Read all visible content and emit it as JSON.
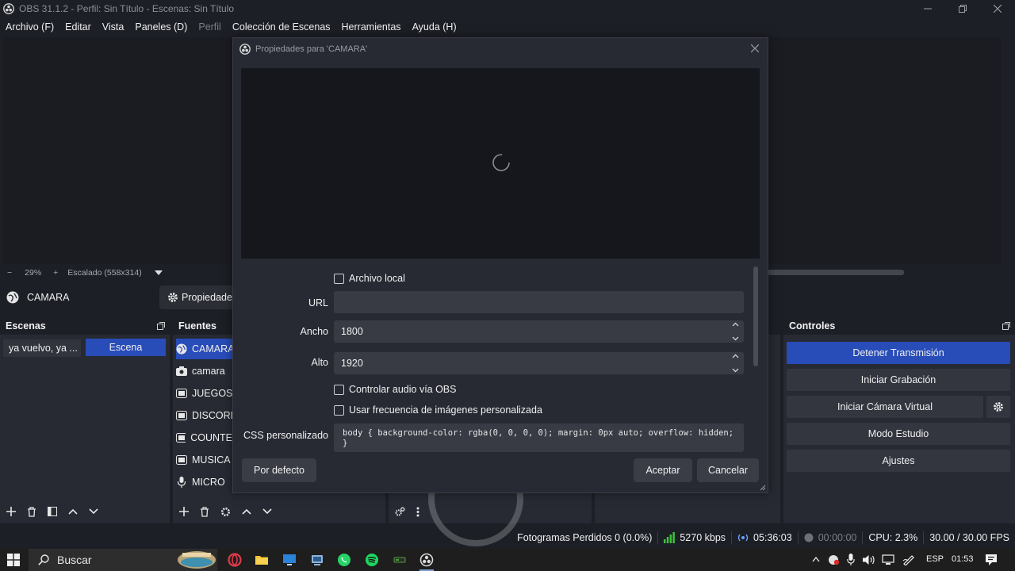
{
  "window": {
    "title": "OBS 31.1.2 - Perfil: Sin Título - Escenas: Sin Título"
  },
  "menu": [
    {
      "label": "Archivo (F)",
      "disabled": false
    },
    {
      "label": "Editar",
      "disabled": false
    },
    {
      "label": "Vista",
      "disabled": false
    },
    {
      "label": "Paneles (D)",
      "disabled": false
    },
    {
      "label": "Perfil",
      "disabled": true
    },
    {
      "label": "Colección de Escenas",
      "disabled": false
    },
    {
      "label": "Herramientas",
      "disabled": false
    },
    {
      "label": "Ayuda (H)",
      "disabled": false
    }
  ],
  "zoom": {
    "minus": "−",
    "level": "29%",
    "plus": "+",
    "scaled": "Escalado (558x314)"
  },
  "source_toolbar": {
    "source_name": "CAMARA",
    "properties_label": "Propiedades"
  },
  "scenes": {
    "header": "Escenas",
    "item": "ya vuelvo, ya ...",
    "scene_button": "Escena"
  },
  "sources": {
    "header": "Fuentes",
    "items": [
      {
        "label": "CAMARA",
        "icon": "browser-icon",
        "selected": true
      },
      {
        "label": "camara",
        "icon": "camera-icon",
        "selected": false
      },
      {
        "label": "JUEGOS",
        "icon": "window-capture-icon",
        "selected": false
      },
      {
        "label": "DISCORD",
        "icon": "window-capture-icon",
        "selected": false
      },
      {
        "label": "COUNTER",
        "icon": "window-capture-icon",
        "selected": false
      },
      {
        "label": "MUSICA",
        "icon": "window-capture-icon",
        "selected": false
      },
      {
        "label": "MICRO",
        "icon": "microphone-icon",
        "selected": false
      }
    ]
  },
  "controls": {
    "header": "Controles",
    "buttons": {
      "stop_stream": "Detener Transmisión",
      "start_recording": "Iniciar Grabación",
      "start_virtual_cam": "Iniciar Cámara Virtual",
      "studio_mode": "Modo Estudio",
      "settings": "Ajustes"
    }
  },
  "dialog": {
    "title": "Propiedades para 'CAMARA'",
    "local_file": "Archivo local",
    "url_label": "URL",
    "url_value": "",
    "width_label": "Ancho",
    "width_value": "1800",
    "height_label": "Alto",
    "height_value": "1920",
    "control_audio": "Controlar audio vía OBS",
    "custom_fps": "Usar frecuencia de imágenes personalizada",
    "css_label": "CSS personalizado",
    "css_value": "body { background-color: rgba(0, 0, 0, 0); margin: 0px auto; overflow: hidden; }",
    "defaults_button": "Por defecto",
    "ok_button": "Aceptar",
    "cancel_button": "Cancelar"
  },
  "status": {
    "dropped_frames": "Fotogramas Perdidos 0 (0.0%)",
    "bitrate": "5270 kbps",
    "stream_time": "05:36:03",
    "record_time": "00:00:00",
    "cpu": "CPU: 2.3%",
    "fps": "30.00 / 30.00 FPS"
  },
  "taskbar": {
    "search_placeholder": "Buscar",
    "language": "ESP",
    "time": "01:53"
  },
  "colors": {
    "accent": "#284cb8",
    "background": "#1d1f26",
    "panel": "#272a33",
    "bitrate_green": "#3cc23c"
  }
}
